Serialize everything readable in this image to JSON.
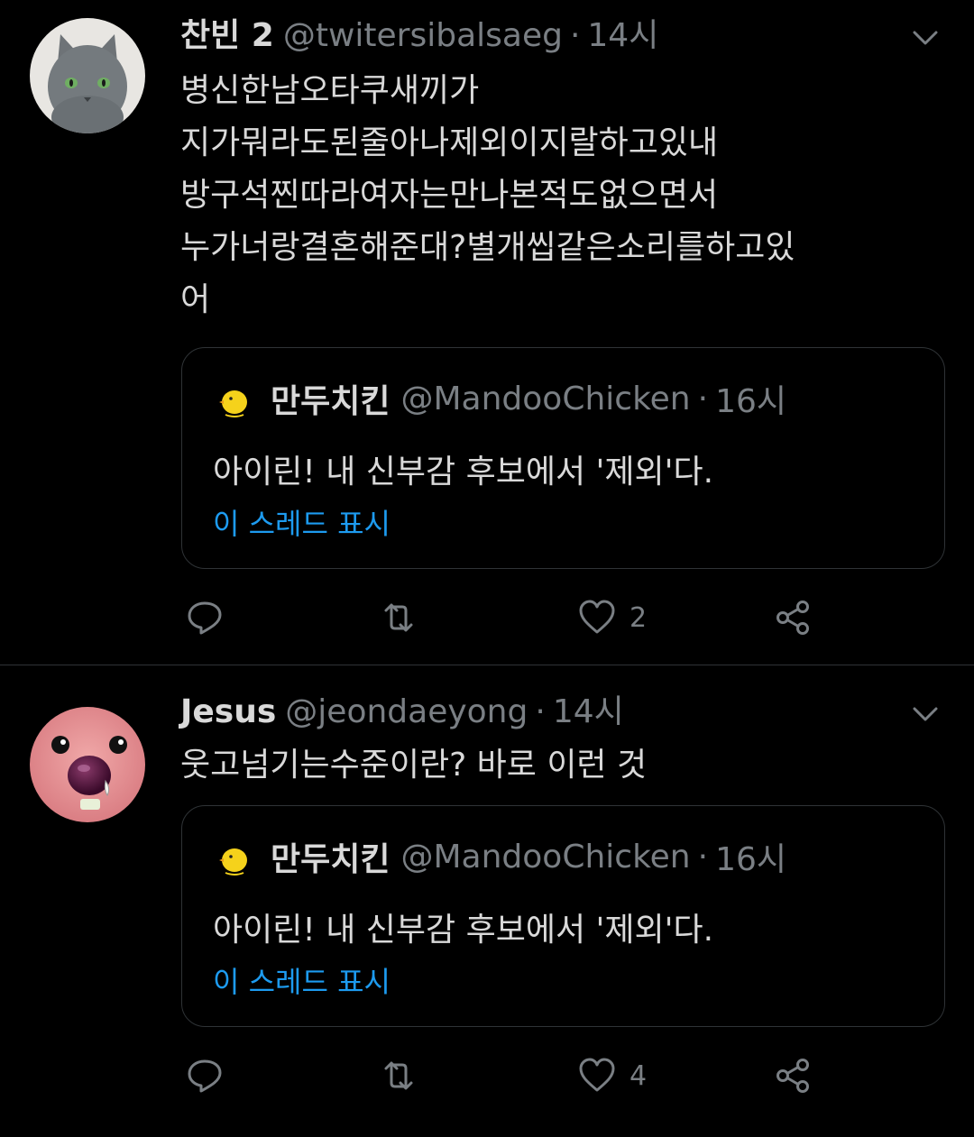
{
  "tweets": [
    {
      "author_name": "찬빈 2",
      "handle": "@twitersibalsaeg",
      "separator": "·",
      "time": "14시",
      "avatar_icon": "gray-cat-avatar",
      "body_lines": [
        "병신한남오타쿠새끼가",
        "지가뭐라도된줄아나제외이지랄하고있내",
        "방구석찐따라여자는만나본적도없으면서",
        "누가너랑결혼해준대?별개씹같은소리를하고있",
        "어"
      ],
      "quote": {
        "author_name": "만두치킨",
        "handle": "@MandooChicken",
        "separator": "·",
        "time": "16시",
        "avatar_icon": "yellow-chick-avatar",
        "text": "아이린! 내 신부감 후보에서 '제외'다.",
        "thread_link": "이 스레드 표시"
      },
      "actions": {
        "reply_count": "",
        "retweet_count": "",
        "like_count": "2"
      }
    },
    {
      "author_name": "Jesus",
      "handle": "@jeondaeyong",
      "separator": "·",
      "time": "14시",
      "avatar_icon": "pink-mole-avatar",
      "body_lines": [
        "웃고넘기는수준이란? 바로 이런 것"
      ],
      "quote": {
        "author_name": "만두치킨",
        "handle": "@MandooChicken",
        "separator": "·",
        "time": "16시",
        "avatar_icon": "yellow-chick-avatar",
        "text": "아이린! 내 신부감 후보에서 '제외'다.",
        "thread_link": "이 스레드 표시"
      },
      "actions": {
        "reply_count": "",
        "retweet_count": "",
        "like_count": "4"
      }
    }
  ],
  "colors": {
    "background": "#000000",
    "text_primary": "#d9d9d9",
    "text_secondary": "#7a7f84",
    "link": "#1d9bf0",
    "border": "#2f3336"
  }
}
